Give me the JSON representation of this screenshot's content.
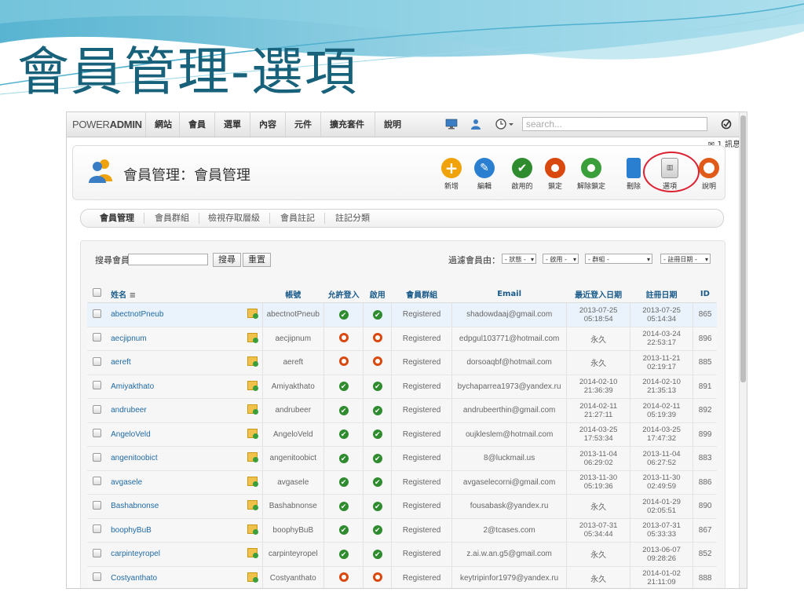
{
  "slide_title": "會員管理-選項",
  "nav": {
    "brand_light": "POWER",
    "brand_bold": "ADMIN",
    "items": [
      "網站",
      "會員",
      "選單",
      "內容",
      "元件",
      "擴充套件",
      "說明"
    ],
    "search_placeholder": "search...",
    "message": "1 訊息"
  },
  "header": {
    "title": "會員管理：會員管理",
    "toolbar": [
      {
        "label": "新增",
        "icon": "plus-icon",
        "color": "#f0a20a"
      },
      {
        "label": "編輯",
        "icon": "pencil-icon",
        "color": "#2a7fd0"
      },
      {
        "label": "啟用的",
        "icon": "check-icon",
        "color": "#2e8b2e"
      },
      {
        "label": "鎖定",
        "icon": "lock-icon",
        "color": "#d9480f"
      },
      {
        "label": "解除鎖定",
        "icon": "unlock-icon",
        "color": "#3a9e3a"
      },
      {
        "label": "刪除",
        "icon": "trash-icon",
        "color": "#2a7fd0"
      },
      {
        "label": "選項",
        "icon": "options-icon",
        "color": "#888888"
      },
      {
        "label": "說明",
        "icon": "help-icon",
        "color": "#e05a1a"
      }
    ]
  },
  "tabs": [
    "會員管理",
    "會員群組",
    "檢視存取層級",
    "會員註記",
    "註記分類"
  ],
  "filters": {
    "search_label": "搜尋會員",
    "search_button": "搜尋",
    "reset_button": "重置",
    "filter_label": "過濾會員由：",
    "selects": [
      "- 狀態 -",
      "- 啟用 -",
      "- 群組 -",
      "- 註冊日期 -"
    ]
  },
  "table": {
    "columns": [
      "姓名",
      "帳號",
      "允許登入",
      "啟用",
      "會員群組",
      "Email",
      "最近登入日期",
      "註冊日期",
      "ID"
    ],
    "rows": [
      {
        "name": "abectnotPneub",
        "username": "abectnotPneub",
        "login": true,
        "enabled": true,
        "group": "Registered",
        "email": "shadowdaaj@gmail.com",
        "last": "2013-07-25 05:18:54",
        "reg": "2013-07-25 05:14:34",
        "id": "865"
      },
      {
        "name": "aecjipnum",
        "username": "aecjipnum",
        "login": false,
        "enabled": false,
        "group": "Registered",
        "email": "edpgul103771@hotmail.com",
        "last": "永久",
        "reg": "2014-03-24 22:53:17",
        "id": "896"
      },
      {
        "name": "aereft",
        "username": "aereft",
        "login": false,
        "enabled": false,
        "group": "Registered",
        "email": "dorsoaqbf@hotmail.com",
        "last": "永久",
        "reg": "2013-11-21 02:19:17",
        "id": "885"
      },
      {
        "name": "Amiyakthato",
        "username": "Amiyakthato",
        "login": true,
        "enabled": true,
        "group": "Registered",
        "email": "bychaparrea1973@yandex.ru",
        "last": "2014-02-10 21:36:39",
        "reg": "2014-02-10 21:35:13",
        "id": "891"
      },
      {
        "name": "andrubeer",
        "username": "andrubeer",
        "login": true,
        "enabled": true,
        "group": "Registered",
        "email": "andrubeerthin@gmail.com",
        "last": "2014-02-11 21:27:11",
        "reg": "2014-02-11 05:19:39",
        "id": "892"
      },
      {
        "name": "AngeloVeld",
        "username": "AngeloVeld",
        "login": true,
        "enabled": true,
        "group": "Registered",
        "email": "oujkleslem@hotmail.com",
        "last": "2014-03-25 17:53:34",
        "reg": "2014-03-25 17:47:32",
        "id": "899"
      },
      {
        "name": "angenitoobict",
        "username": "angenitoobict",
        "login": true,
        "enabled": true,
        "group": "Registered",
        "email": "8@luckmail.us",
        "last": "2013-11-04 06:29:02",
        "reg": "2013-11-04 06:27:52",
        "id": "883"
      },
      {
        "name": "avgasele",
        "username": "avgasele",
        "login": true,
        "enabled": true,
        "group": "Registered",
        "email": "avgaselecorni@gmail.com",
        "last": "2013-11-30 05:19:36",
        "reg": "2013-11-30 02:49:59",
        "id": "886"
      },
      {
        "name": "Bashabnonse",
        "username": "Bashabnonse",
        "login": true,
        "enabled": true,
        "group": "Registered",
        "email": "fousabask@yandex.ru",
        "last": "永久",
        "reg": "2014-01-29 02:05:51",
        "id": "890"
      },
      {
        "name": "boophyBuB",
        "username": "boophyBuB",
        "login": true,
        "enabled": true,
        "group": "Registered",
        "email": "2@tcases.com",
        "last": "2013-07-31 05:34:44",
        "reg": "2013-07-31 05:33:33",
        "id": "867"
      },
      {
        "name": "carpinteyropel",
        "username": "carpinteyropel",
        "login": true,
        "enabled": true,
        "group": "Registered",
        "email": "z.ai.w.an.g5@gmail.com",
        "last": "永久",
        "reg": "2013-06-07 09:28:26",
        "id": "852"
      },
      {
        "name": "Costyanthato",
        "username": "Costyanthato",
        "login": false,
        "enabled": false,
        "group": "Registered",
        "email": "keytripinfor1979@yandex.ru",
        "last": "永久",
        "reg": "2014-01-02 21:11:09",
        "id": "888"
      }
    ]
  }
}
